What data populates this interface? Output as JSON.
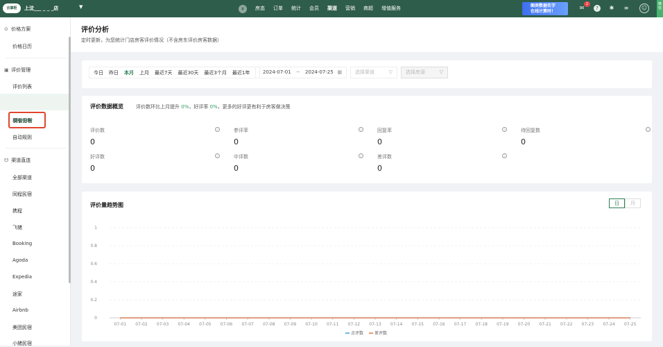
{
  "topbar": {
    "logo": "云掌柜",
    "store_name": "上沈___ _ _ _店",
    "nav": [
      "房态",
      "订单",
      "统计",
      "会员",
      "渠道",
      "营销",
      "商超",
      "增值服务"
    ],
    "active_nav": "渠道",
    "promo_line1": "图类数据名字",
    "promo_line2": "在线计算时！",
    "notification_count": "2",
    "side_tab": "微信"
  },
  "sidebar": {
    "groups": [
      {
        "label": "价格方案",
        "icon": "price-icon"
      },
      {
        "label": "评价管理",
        "icon": "comment-icon"
      },
      {
        "label": "渠道直连",
        "icon": "channel-icon"
      }
    ],
    "items": [
      "价格日历",
      "评价列表",
      "评价分析",
      "模版管理",
      "自动规则",
      "全部渠道",
      "同程民宿",
      "携程",
      "飞猪",
      "Booking",
      "Agoda",
      "Expedia",
      "途家",
      "Airbnb",
      "美团民宿",
      "小猪民宿"
    ],
    "active_item": "评价分析"
  },
  "header": {
    "title": "评价分析",
    "subtitle": "定时更新，为您统计门店房客评价情况（不含房东评价房客数据）"
  },
  "filter": {
    "ranges": [
      "今日",
      "昨日",
      "本月",
      "上月",
      "最近7天",
      "最近30天",
      "最近3个月",
      "最近1年"
    ],
    "selected_range": "本月",
    "date_start": "2024-07-01",
    "date_sep": "~",
    "date_end": "2024-07-25",
    "channel_placeholder": "选择渠道",
    "room_placeholder": "选择房源"
  },
  "overview": {
    "title": "评价数据概览",
    "note_prefix": "评价数环比上月提升",
    "note_value1": "0%",
    "note_mid": "，好评率",
    "note_value2": "0%",
    "note_suffix": "，更多的好评更有利于房客做决策",
    "metrics": [
      {
        "label": "评价数",
        "value": "0"
      },
      {
        "label": "参评率",
        "value": "0"
      },
      {
        "label": "回复率",
        "value": "0"
      },
      {
        "label": "待回复数",
        "value": "0"
      },
      {
        "label": "好评数",
        "value": "0"
      },
      {
        "label": "中评数",
        "value": "0"
      },
      {
        "label": "差评数",
        "value": "0"
      }
    ]
  },
  "trend": {
    "title": "评价量趋势图",
    "toggle": [
      "日",
      "月"
    ],
    "toggle_active": "日"
  },
  "chart_data": {
    "type": "line",
    "categories": [
      "07-01",
      "07-02",
      "07-03",
      "07-04",
      "07-05",
      "07-06",
      "07-07",
      "07-08",
      "07-09",
      "07-10",
      "07-11",
      "07-12",
      "07-13",
      "07-14",
      "07-15",
      "07-16",
      "07-17",
      "07-18",
      "07-19",
      "07-20",
      "07-21",
      "07-22",
      "07-23",
      "07-24",
      "07-25"
    ],
    "series": [
      {
        "name": "点评数",
        "color": "#3aa0d8",
        "values": [
          0,
          0,
          0,
          0,
          0,
          0,
          0,
          0,
          0,
          0,
          0,
          0,
          0,
          0,
          0,
          0,
          0,
          0,
          0,
          0,
          0,
          0,
          0,
          0,
          0
        ]
      },
      {
        "name": "差评数",
        "color": "#e8743b",
        "values": [
          0,
          0,
          0,
          0,
          0,
          0,
          0,
          0,
          0,
          0,
          0,
          0,
          0,
          0,
          0,
          0,
          0,
          0,
          0,
          0,
          0,
          0,
          0,
          0,
          0
        ]
      }
    ],
    "yticks": [
      "0",
      "0.2",
      "0.4",
      "0.6",
      "0.8",
      "1"
    ],
    "ylim": [
      0,
      1
    ],
    "grid": true,
    "legend": "bottom"
  }
}
